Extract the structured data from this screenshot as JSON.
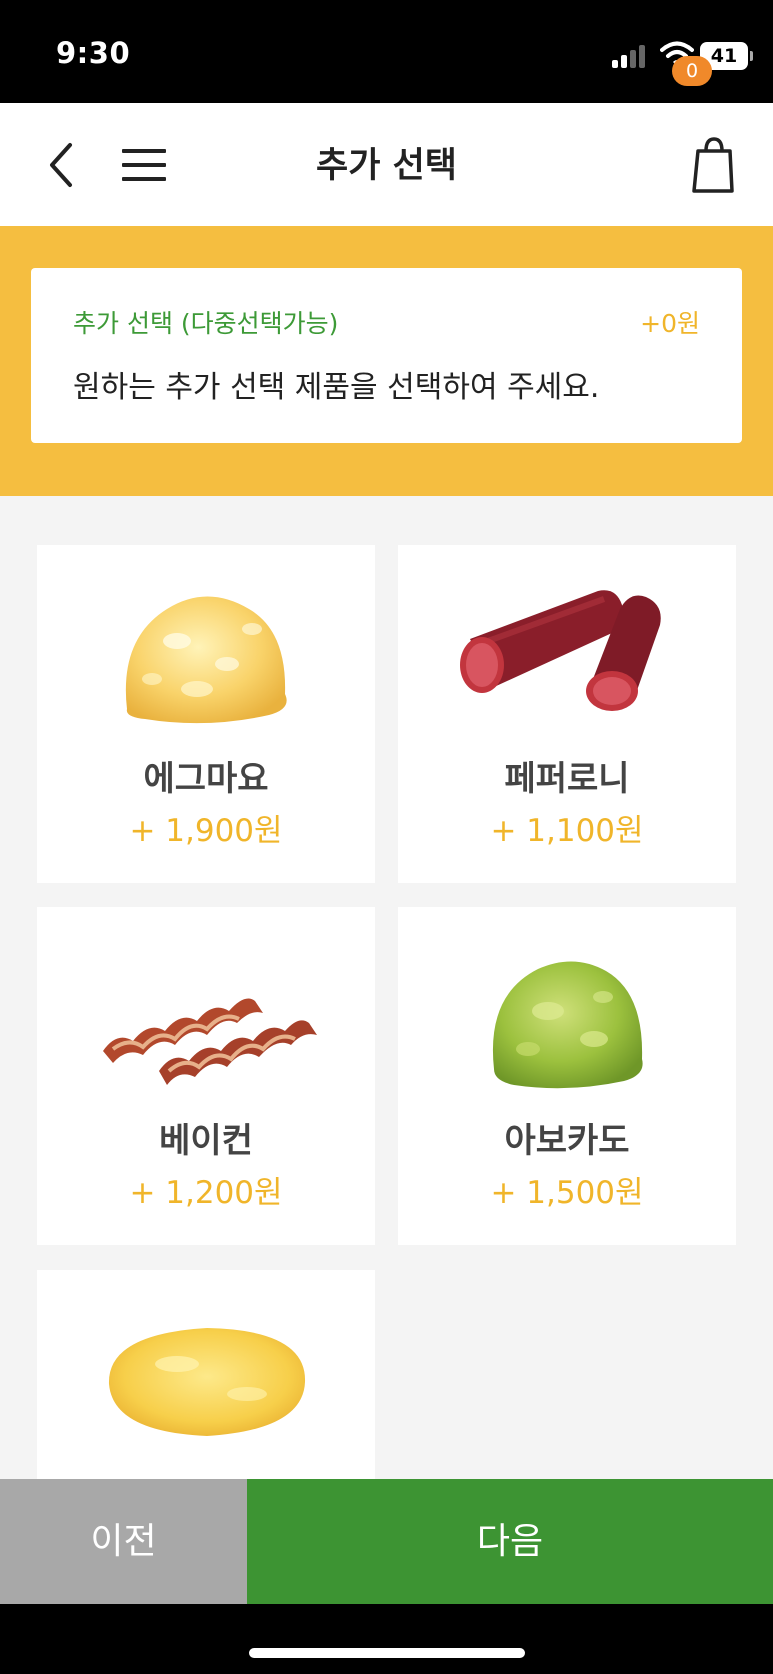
{
  "status_bar": {
    "time": "9:30",
    "battery": "41",
    "icons": [
      "signal-icon",
      "wifi-icon",
      "battery-icon"
    ]
  },
  "header": {
    "title": "추가 선택",
    "cart_count": "0",
    "icons": [
      "back-icon",
      "menu-icon",
      "shopping-bag-icon"
    ]
  },
  "info": {
    "label": "추가 선택 (다중선택가능)",
    "price": "+0원",
    "description": "원하는 추가 선택 제품을 선택하여 주세요."
  },
  "options": [
    {
      "name": "에그마요",
      "price": "+ 1,900원"
    },
    {
      "name": "페퍼로니",
      "price": "+ 1,100원"
    },
    {
      "name": "베이컨",
      "price": "+ 1,200원"
    },
    {
      "name": "아보카도",
      "price": "+ 1,500원"
    }
  ],
  "footer": {
    "prev_label": "이전",
    "next_label": "다음"
  },
  "colors": {
    "accent_yellow": "#f5be40",
    "price_yellow": "#f0b52a",
    "label_green": "#3d9a37",
    "next_green": "#3d9433",
    "prev_gray": "#a8a8a8",
    "badge_orange": "#f0892a"
  }
}
